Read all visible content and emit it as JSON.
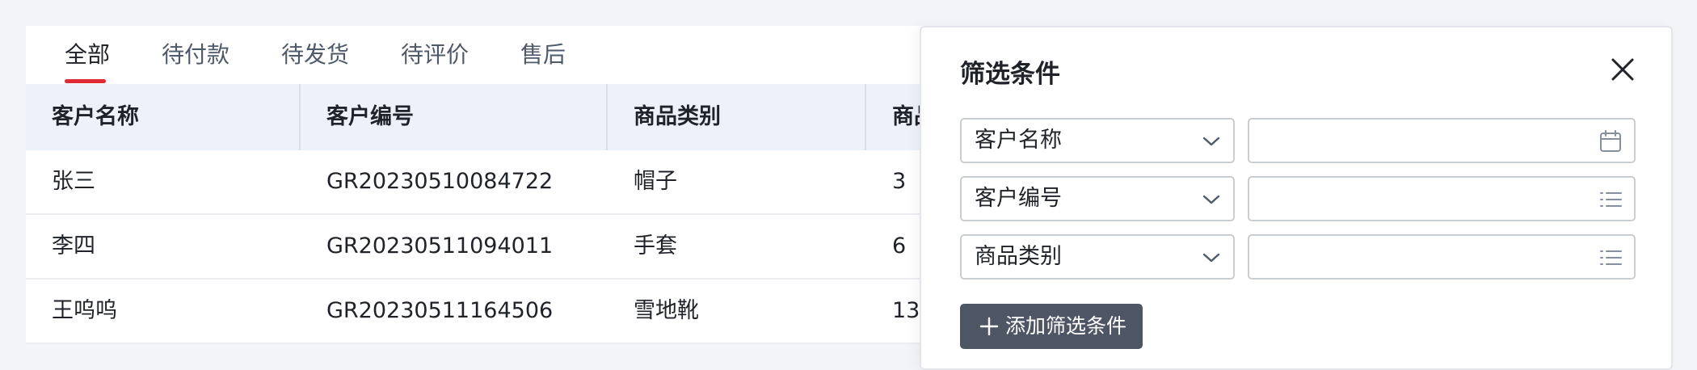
{
  "tabs": [
    {
      "label": "全部",
      "active": true
    },
    {
      "label": "待付款",
      "active": false
    },
    {
      "label": "待发货",
      "active": false
    },
    {
      "label": "待评价",
      "active": false
    },
    {
      "label": "售后",
      "active": false
    }
  ],
  "table": {
    "headers": [
      "客户名称",
      "客户编号",
      "商品类别",
      "商品"
    ],
    "rows": [
      [
        "张三",
        "GR20230510084722",
        "帽子",
        "3"
      ],
      [
        "李四",
        "GR20230511094011",
        "手套",
        "6"
      ],
      [
        "王呜呜",
        "GR20230511164506",
        "雪地靴",
        "13"
      ]
    ]
  },
  "filter_panel": {
    "title": "筛选条件",
    "fields": [
      {
        "label": "客户名称",
        "value": "",
        "icon": "calendar-icon"
      },
      {
        "label": "客户编号",
        "value": "",
        "icon": "list-icon"
      },
      {
        "label": "商品类别",
        "value": "",
        "icon": "list-icon"
      }
    ],
    "add_button_label": "添加筛选条件"
  },
  "colors": {
    "accent": "#e02a36",
    "header_bg": "#edf1f9",
    "button_bg": "#4e5565"
  }
}
